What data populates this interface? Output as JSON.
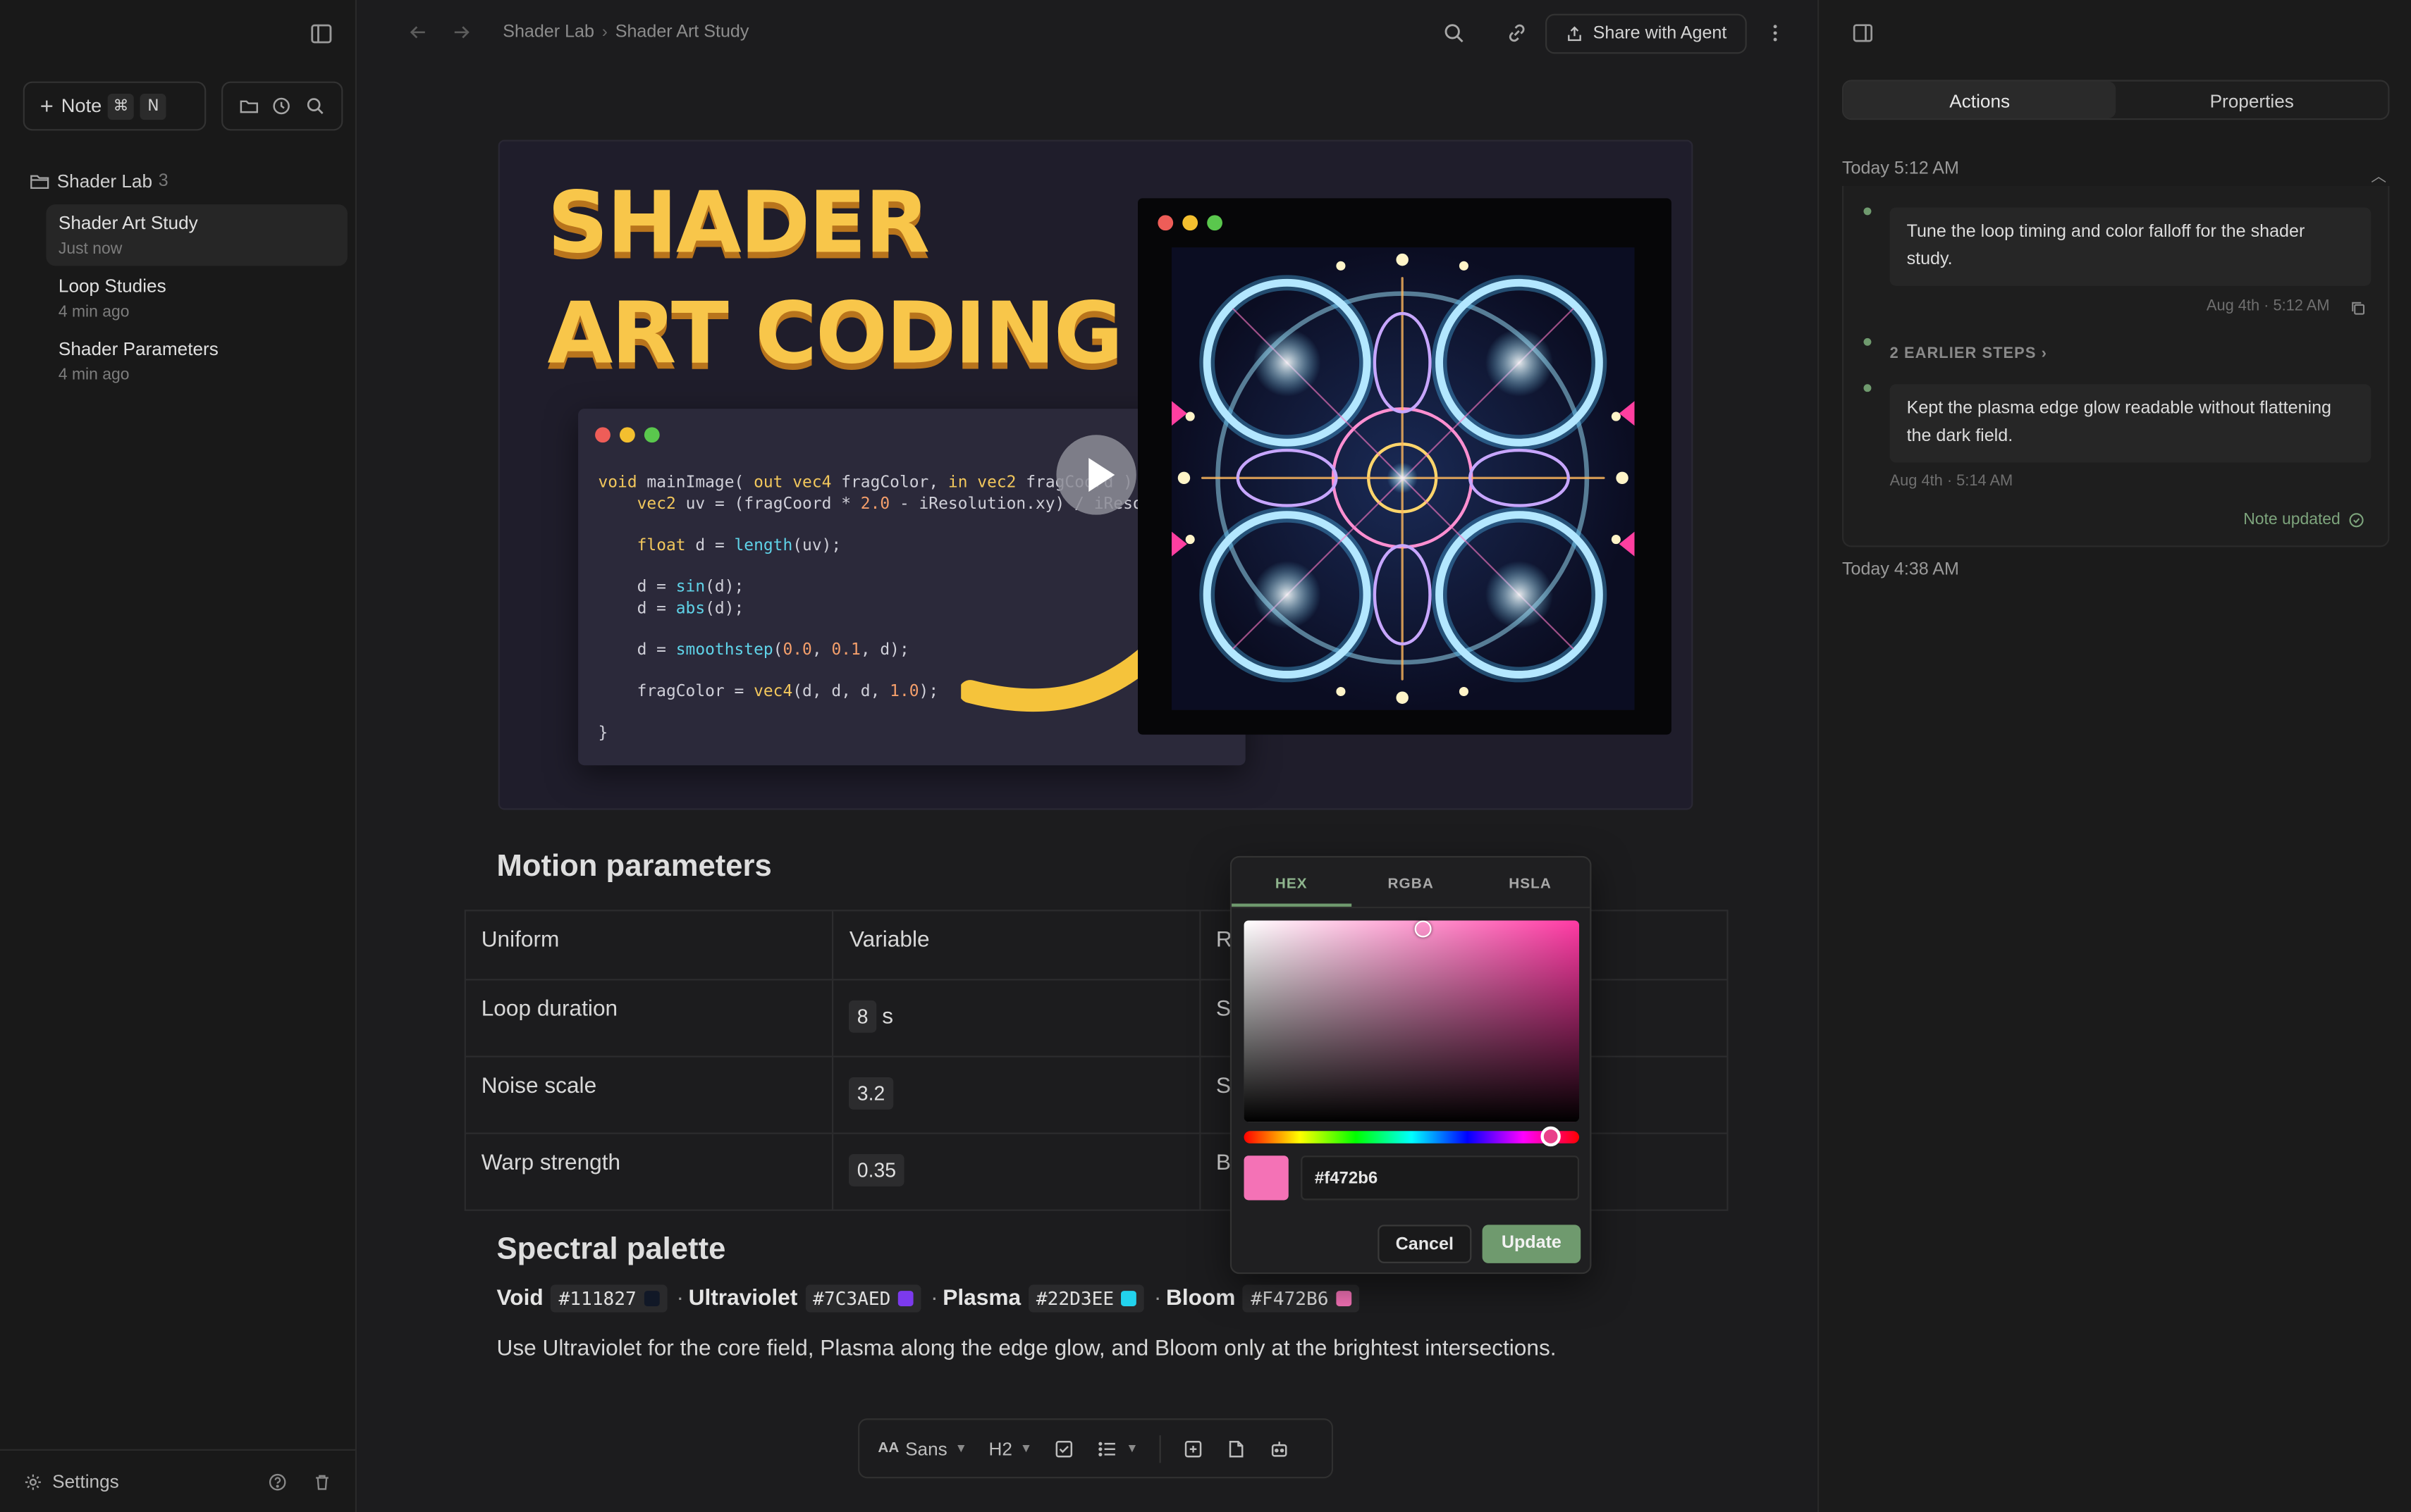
{
  "sidebar": {
    "new_note_label": "Note",
    "shortcut_keys": [
      "⌘",
      "N"
    ],
    "folder": {
      "name": "Shader Lab",
      "count": "3"
    },
    "notes": [
      {
        "title": "Shader Art Study",
        "time": "Just now"
      },
      {
        "title": "Loop Studies",
        "time": "4 min ago"
      },
      {
        "title": "Shader Parameters",
        "time": "4 min ago"
      }
    ],
    "settings_label": "Settings"
  },
  "header": {
    "breadcrumb": [
      "Shader Lab",
      "Shader Art Study"
    ],
    "share_label": "Share with Agent"
  },
  "hero": {
    "title_line1": "SHADER",
    "title_line2": "ART CODING",
    "code_lines": [
      "void mainImage( out vec4 fragColor, in vec2 fragCoord ) {",
      "    vec2 uv = (fragCoord * 2.0 - iResolution.xy) / iResol",
      "",
      "    float d = length(uv);",
      "",
      "    d = sin(d);",
      "    d = abs(d);",
      "",
      "    d = smoothstep(0.0, 0.1, d);",
      "",
      "    fragColor = vec4(d, d, d, 1.0);",
      "",
      "}"
    ]
  },
  "motion": {
    "heading": "Motion parameters",
    "headers": [
      "Uniform",
      "Variable",
      "Re"
    ],
    "rows": [
      {
        "uniform": "Loop duration",
        "value": "8",
        "unit": "s",
        "extra": "Se"
      },
      {
        "uniform": "Noise scale",
        "value": "3.2",
        "unit": "",
        "extra": "Sl"
      },
      {
        "uniform": "Warp strength",
        "value": "0.35",
        "unit": "",
        "extra": "Be"
      }
    ]
  },
  "palette": {
    "heading": "Spectral palette",
    "entries": [
      {
        "name": "Void",
        "hex": "#111827",
        "color": "#111827"
      },
      {
        "name": "Ultraviolet",
        "hex": "#7C3AED",
        "color": "#7C3AED"
      },
      {
        "name": "Plasma",
        "hex": "#22D3EE",
        "color": "#22D3EE"
      },
      {
        "name": "Bloom",
        "hex": "#F472B6",
        "color": "#F472B6"
      }
    ],
    "separator": "·",
    "body": "Use Ultraviolet for the core field, Plasma along the edge glow, and Bloom only at the brightest intersections."
  },
  "picker": {
    "tabs": [
      "HEX",
      "RGBA",
      "HSLA"
    ],
    "active_tab": "HEX",
    "hex_value": "#f472b6",
    "swatch_color": "#f472b6",
    "cancel_label": "Cancel",
    "update_label": "Update"
  },
  "toolbar": {
    "font_label": "Sans",
    "font_prefix": "AA",
    "heading_label": "H2"
  },
  "right_panel": {
    "tabs": [
      "Actions",
      "Properties"
    ],
    "active_tab": "Actions",
    "group1_label": "Today 5:12 AM",
    "messages": [
      {
        "text": "Tune the loop timing and color falloff for the shader study.",
        "meta": "Aug 4th · 5:12 AM"
      },
      {
        "text": "Kept the plasma edge glow readable without flattening the dark field.",
        "meta": "Aug 4th · 5:14 AM"
      }
    ],
    "earlier_steps": "2 EARLIER STEPS",
    "status": "Note updated",
    "group2_label": "Today 4:38 AM"
  }
}
